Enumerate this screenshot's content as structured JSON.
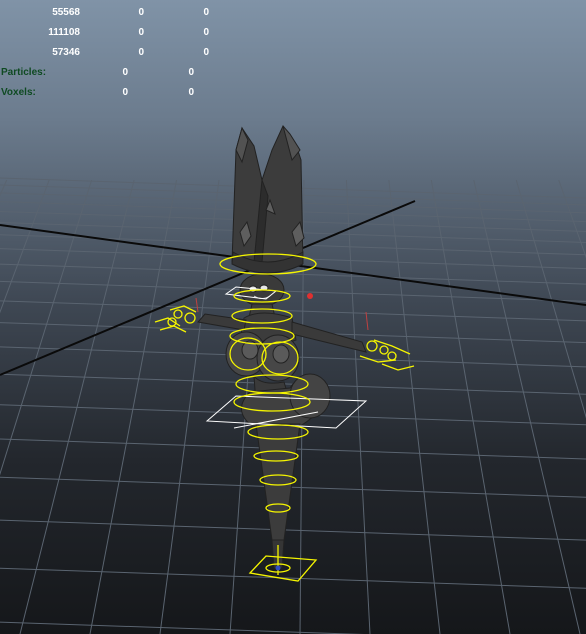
{
  "hud": {
    "rows": [
      {
        "label": "",
        "total": "55568",
        "c1": "0",
        "c2": "0"
      },
      {
        "label": "",
        "total": "111108",
        "c1": "0",
        "c2": "0"
      },
      {
        "label": "",
        "total": "57346",
        "c1": "0",
        "c2": "0"
      },
      {
        "label": "Particles:",
        "total": "",
        "c1": "0",
        "c2": "0"
      },
      {
        "label": "Voxels:",
        "total": "",
        "c1": "0",
        "c2": "0"
      }
    ]
  },
  "colors": {
    "grid_line": "#5a6470",
    "axis_line": "#0a0a0a",
    "model_fill": "#3c3c3c",
    "model_edge": "#222222",
    "rig_control": "#f5f500",
    "selection_white": "#ffffff",
    "hud_label": "#0f4a22",
    "hud_value": "#ffffff"
  },
  "icons": {
    "model": "3d-character-mesh-icon",
    "rig": "rig-control-curves-icon"
  }
}
